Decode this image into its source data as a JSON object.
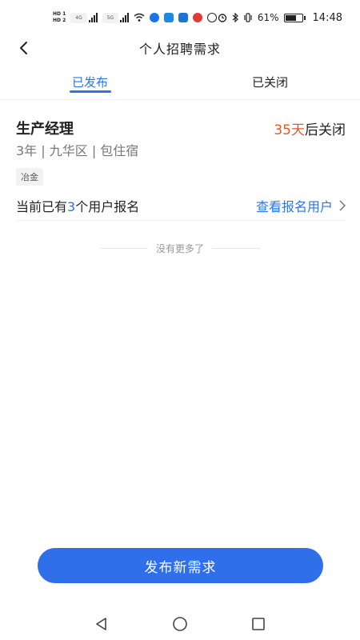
{
  "status_bar": {
    "hd1": "HD 1",
    "hd2": "HD 2",
    "net1": "4G",
    "net2": "5G",
    "battery_percent": "61%",
    "battery_level": 0.61,
    "time": "14:48"
  },
  "header": {
    "title": "个人招聘需求",
    "back_icon": "chevron-left-icon"
  },
  "tabs": [
    {
      "label": "已发布",
      "active": true
    },
    {
      "label": "已关闭",
      "active": false
    }
  ],
  "job": {
    "title": "生产经理",
    "days": "35天",
    "close_suffix": "后关闭",
    "meta": "3年 | 九华区 | 包住宿",
    "tag": "冶金",
    "enroll_prefix": "当前已有",
    "enroll_count": "3",
    "enroll_suffix": "个用户报名",
    "view_link": "查看报名用户"
  },
  "list_end_text": "没有更多了",
  "publish_button": "发布新需求",
  "colors": {
    "accent": "#2b76e6",
    "button": "#2f6fea",
    "highlight": "#e05a2b"
  },
  "nav": [
    "back-triangle-icon",
    "home-circle-icon",
    "recents-square-icon"
  ]
}
